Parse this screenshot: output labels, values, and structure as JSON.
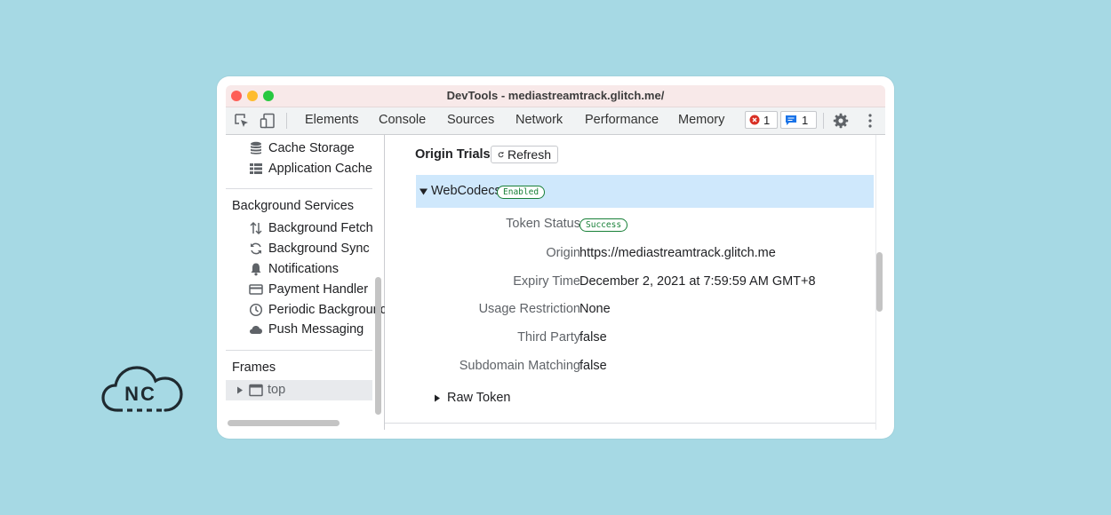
{
  "logo": {
    "text": "NC"
  },
  "window": {
    "title": "DevTools - mediastreamtrack.glitch.me/"
  },
  "toolbar": {
    "tabs": [
      "Elements",
      "Console",
      "Sources",
      "Network",
      "Performance",
      "Memory"
    ],
    "error_count": "1",
    "message_count": "1"
  },
  "sidebar": {
    "cache_items": [
      "Cache Storage",
      "Application Cache"
    ],
    "background_services_title": "Background Services",
    "background_items": [
      "Background Fetch",
      "Background Sync",
      "Notifications",
      "Payment Handler",
      "Periodic Background Sync",
      "Push Messaging"
    ],
    "frames_title": "Frames",
    "frames_item": "top"
  },
  "main": {
    "heading": "Origin Trials",
    "refresh_label": "Refresh",
    "trial": {
      "name": "WebCodecs",
      "status_badge": "Enabled"
    },
    "rows": [
      {
        "label": "Token Status",
        "value": "Success"
      },
      {
        "label": "Origin",
        "value": "https://mediastreamtrack.glitch.me"
      },
      {
        "label": "Expiry Time",
        "value": "December 2, 2021 at 7:59:59 AM GMT+8"
      },
      {
        "label": "Usage Restriction",
        "value": "None"
      },
      {
        "label": "Third Party",
        "value": "false"
      },
      {
        "label": "Subdomain Matching",
        "value": "false"
      }
    ],
    "raw_token_label": "Raw Token"
  },
  "colors": {
    "background": "#a6d9e4",
    "selected_row": "#cfe8fc",
    "success_green": "#188038",
    "error_red": "#d93025",
    "info_blue": "#1a73e8"
  }
}
